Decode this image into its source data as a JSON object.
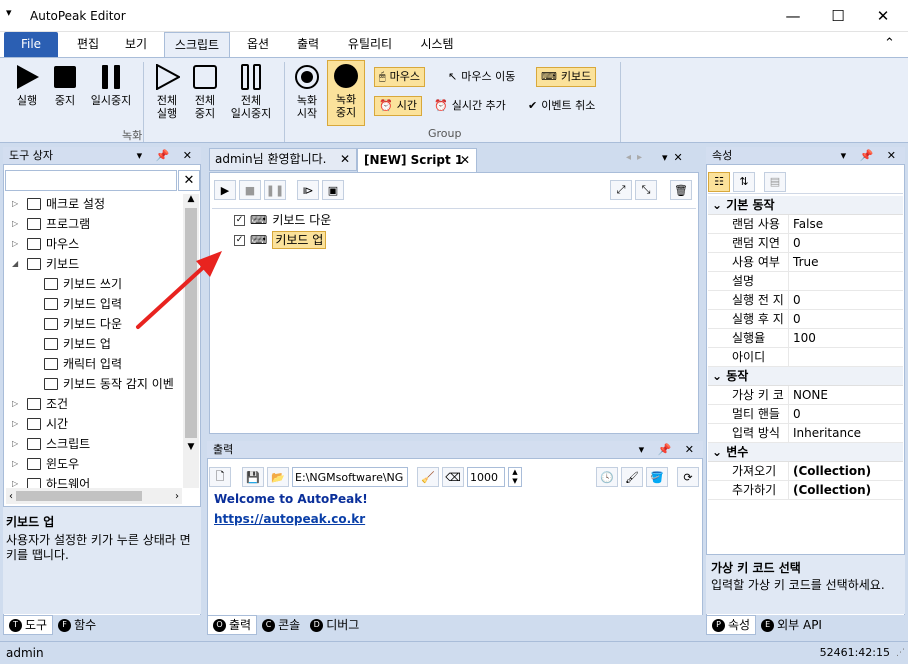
{
  "window": {
    "title": "AutoPeak Editor",
    "menu_glyph": "▾",
    "minimize": "—",
    "maximize": "☐",
    "close": "✕"
  },
  "ribbon_tabs": [
    "File",
    "편집",
    "보기",
    "스크립트",
    "옵션",
    "출력",
    "유틸리티",
    "시스템"
  ],
  "ribbon_collapse": "⌃",
  "ribbon": {
    "groups": [
      "녹화",
      "Group"
    ],
    "buttons": {
      "run": "실행",
      "stop": "중지",
      "pause": "일시중지",
      "run_all_1": "전체",
      "run_all_2": "실행",
      "stop_all_1": "전체",
      "stop_all_2": "중지",
      "pause_all_1": "전체",
      "pause_all_2": "일시중지",
      "rec_start_1": "녹화",
      "rec_start_2": "시작",
      "rec_stop_1": "녹화",
      "rec_stop_2": "중지"
    },
    "small": {
      "mouse": "마우스",
      "mouse_move": "마우스 이동",
      "keyboard": "키보드",
      "time": "시간",
      "realtime_add": "실시간 추가",
      "event_cancel": "이벤트 취소"
    }
  },
  "toolbox": {
    "title": "도구 상자",
    "search_value": "",
    "items": [
      {
        "label": "매크로 설정",
        "level": 0,
        "exp": "▷"
      },
      {
        "label": "프로그램",
        "level": 0,
        "exp": "▷"
      },
      {
        "label": "마우스",
        "level": 0,
        "exp": "▷"
      },
      {
        "label": "키보드",
        "level": 0,
        "exp": "◢"
      },
      {
        "label": "키보드 쓰기",
        "level": 1,
        "exp": ""
      },
      {
        "label": "키보드 입력",
        "level": 1,
        "exp": ""
      },
      {
        "label": "키보드 다운",
        "level": 1,
        "exp": ""
      },
      {
        "label": "키보드 업",
        "level": 1,
        "exp": ""
      },
      {
        "label": "캐릭터 입력",
        "level": 1,
        "exp": ""
      },
      {
        "label": "키보드 동작 감지 이벤",
        "level": 1,
        "exp": ""
      },
      {
        "label": "조건",
        "level": 0,
        "exp": "▷"
      },
      {
        "label": "시간",
        "level": 0,
        "exp": "▷"
      },
      {
        "label": "스크립트",
        "level": 0,
        "exp": "▷"
      },
      {
        "label": "윈도우",
        "level": 0,
        "exp": "▷"
      },
      {
        "label": "하드웨어",
        "level": 0,
        "exp": "▷"
      }
    ],
    "desc_title": "키보드 업",
    "desc_text": "사용자가 설정한 키가 누른 상태라 면 키를 땝니다.",
    "tabs": [
      "도구",
      "함수"
    ]
  },
  "editor": {
    "tabs": [
      "admin님 환영합니다.",
      "[NEW] Script 1"
    ],
    "script_items": [
      "키보드 다운",
      "키보드 업"
    ]
  },
  "output": {
    "title": "출력",
    "path_value": "E:\\NGMsoftware\\NG",
    "number_value": "1000",
    "welcome": "Welcome to AutoPeak!",
    "link": "https://autopeak.co.kr",
    "tabs": [
      "출력",
      "콘솔",
      "디버그"
    ]
  },
  "properties": {
    "title": "속성",
    "categories": [
      {
        "name": "기본 동작",
        "rows": [
          [
            "랜덤 사용",
            "False"
          ],
          [
            "랜덤 지연",
            "0"
          ],
          [
            "사용 여부",
            "True"
          ],
          [
            "설명",
            ""
          ],
          [
            "실행 전 지",
            "0"
          ],
          [
            "실행 후 지",
            "0"
          ],
          [
            "실행율",
            "100"
          ],
          [
            "아이디",
            ""
          ]
        ]
      },
      {
        "name": "동작",
        "rows": [
          [
            "가상 키 코",
            "NONE"
          ],
          [
            "멀티 핸들",
            "0"
          ],
          [
            "입력 방식",
            "Inheritance"
          ]
        ]
      },
      {
        "name": "변수",
        "rows": [
          [
            "가져오기",
            "(Collection)"
          ],
          [
            "추가하기",
            "(Collection)"
          ]
        ]
      }
    ],
    "desc_title": "가상 키 코드 선택",
    "desc_text": "입력할 가상 키 코드를 선택하세요.",
    "tabs": [
      "속성",
      "외부 API"
    ]
  },
  "status": {
    "user": "admin",
    "time": "52461:42:15"
  },
  "colors": {
    "accent": "#2b5fb3",
    "highlight": "#fbe29b",
    "arrow": "#e8231f",
    "link": "#0a3fa8"
  }
}
